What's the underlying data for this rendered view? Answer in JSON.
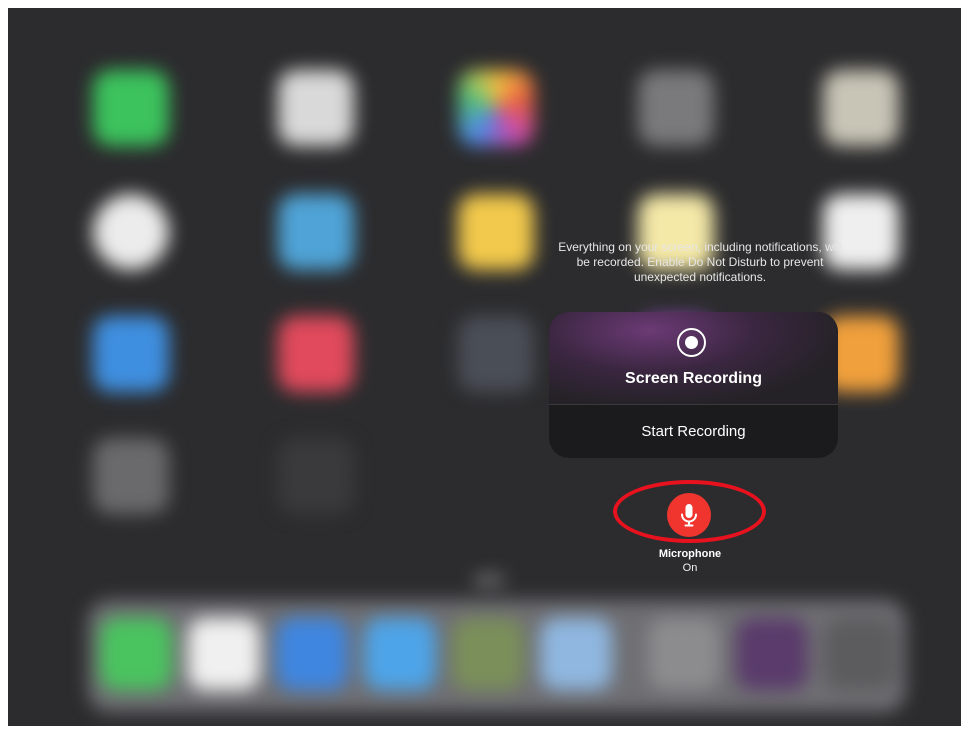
{
  "info_text": "Everything on your screen, including notifications, will be recorded. Enable Do Not Disturb to prevent unexpected notifications.",
  "sheet": {
    "icon": "record-icon",
    "title": "Screen Recording",
    "start_button": "Start Recording"
  },
  "microphone": {
    "icon": "microphone-icon",
    "label": "Microphone",
    "state": "On",
    "color": "#f0352e"
  },
  "annotation": {
    "color": "#e8121e"
  },
  "colors": {
    "background": "#2c2c2e",
    "sheet_background": "#1b1b1d"
  }
}
